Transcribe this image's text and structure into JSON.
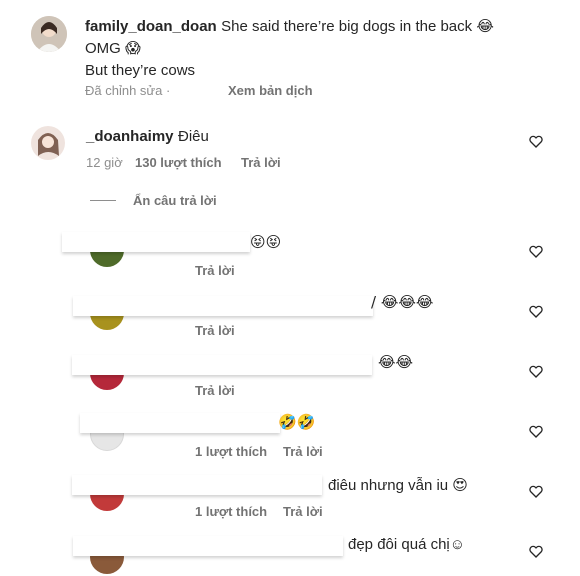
{
  "top_comment": {
    "username": "family_doan_doan",
    "text_line1": "She said there’re big dogs in the back 😂",
    "text_line2": "OMG 😱",
    "text_line3": "But they’re cows",
    "edited_label": "Đã chỉnh sửa ·",
    "translate_label": "Xem bản dịch"
  },
  "reply_main": {
    "username": "_doanhaimy",
    "text": "Điêu",
    "time": "12 giờ",
    "likes": "130 lượt thích",
    "reply_label": "Trả lời"
  },
  "hide_replies_label": "Ẩn câu trả lời",
  "replies": [
    {
      "text": "😝😝",
      "likes": "",
      "reply_label": "Trả lời",
      "avatar_color": "#4f6b2a"
    },
    {
      "text": "/ 😂😂😂",
      "likes": "",
      "reply_label": "Trả lời",
      "avatar_color": "#a8921e"
    },
    {
      "text": "😂😂",
      "likes": "",
      "reply_label": "Trả lời",
      "avatar_color": "#b5283a"
    },
    {
      "text": "🤣🤣",
      "likes": "1 lượt thích",
      "reply_label": "Trả lời",
      "avatar_color": "#e6e6e6"
    },
    {
      "text": "điêu nhưng vẫn iu 😍",
      "likes": "1 lượt thích",
      "reply_label": "Trả lời",
      "avatar_color": "#c23a3a"
    },
    {
      "text": "đẹp đôi quá chị☺",
      "likes": "",
      "reply_label": "",
      "avatar_color": "#8a5a3a"
    }
  ]
}
